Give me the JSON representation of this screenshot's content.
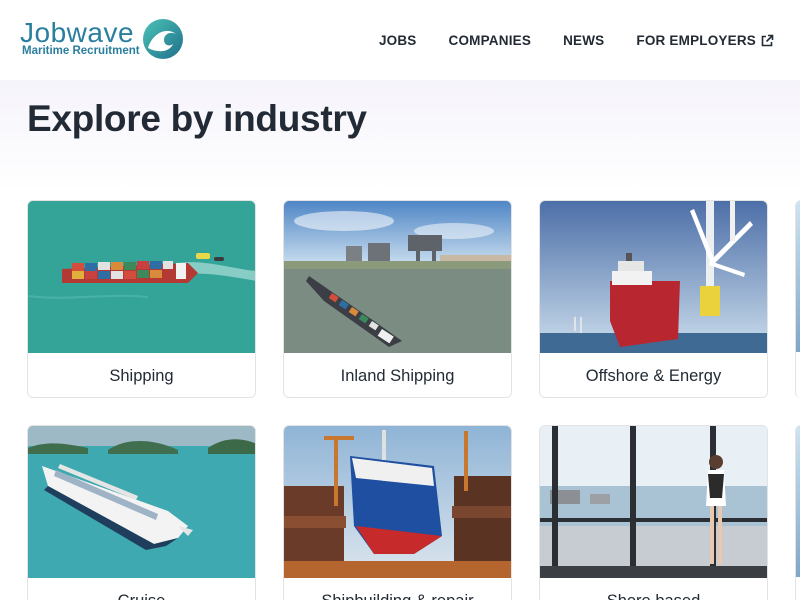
{
  "brand": {
    "name": "Jobwave",
    "tagline": "Maritime Recruitment",
    "accent": "#2a7f9e",
    "logo_icon": "wave-icon"
  },
  "nav": {
    "items": [
      {
        "label": "JOBS"
      },
      {
        "label": "COMPANIES"
      },
      {
        "label": "NEWS"
      },
      {
        "label": "FOR EMPLOYERS",
        "icon": "external-link-icon"
      }
    ]
  },
  "page": {
    "title": "Explore by industry"
  },
  "industries": [
    {
      "label": "Shipping"
    },
    {
      "label": "Inland Shipping"
    },
    {
      "label": "Offshore & Energy"
    },
    {
      "label": "Cruise"
    },
    {
      "label": "Shipbuilding & repair"
    },
    {
      "label": "Shore based"
    }
  ],
  "colors": {
    "text": "#222b35",
    "card_border": "#e3e3e3",
    "band": "#f6f4fb"
  }
}
